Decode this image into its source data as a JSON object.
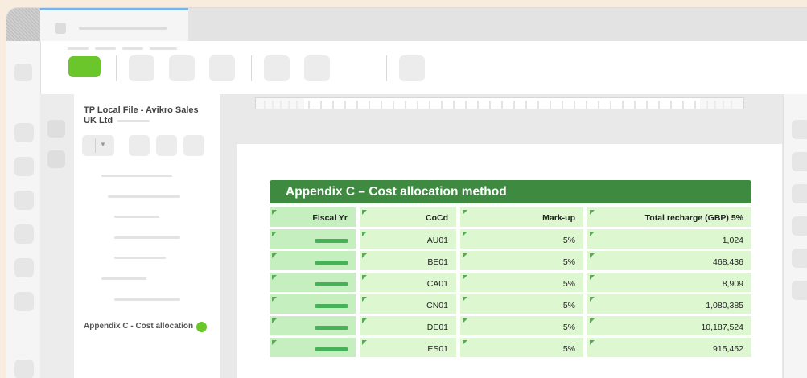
{
  "outline": {
    "doc_title": "TP Local File - Avikro Sales UK Ltd",
    "active_item": "Appendix C - Cost allocation"
  },
  "table": {
    "title": "Appendix C – Cost allocation method",
    "headers": [
      "Fiscal Yr",
      "CoCd",
      "Mark-up",
      "Total recharge (GBP) 5%"
    ],
    "rows": [
      {
        "fiscal_yr": "",
        "cocd": "AU01",
        "markup": "5%",
        "total": "1,024"
      },
      {
        "fiscal_yr": "",
        "cocd": "BE01",
        "markup": "5%",
        "total": "468,436"
      },
      {
        "fiscal_yr": "",
        "cocd": "CA01",
        "markup": "5%",
        "total": "8,909"
      },
      {
        "fiscal_yr": "",
        "cocd": "CN01",
        "markup": "5%",
        "total": "1,080,385"
      },
      {
        "fiscal_yr": "",
        "cocd": "DE01",
        "markup": "5%",
        "total": "10,187,524"
      },
      {
        "fiscal_yr": "",
        "cocd": "ES01",
        "markup": "5%",
        "total": "915,452"
      }
    ]
  },
  "colors": {
    "accent_green": "#6ac62b",
    "banner_green": "#3f8a41",
    "cell_green": "#ddf7d0",
    "background": "#f8ecdf"
  }
}
